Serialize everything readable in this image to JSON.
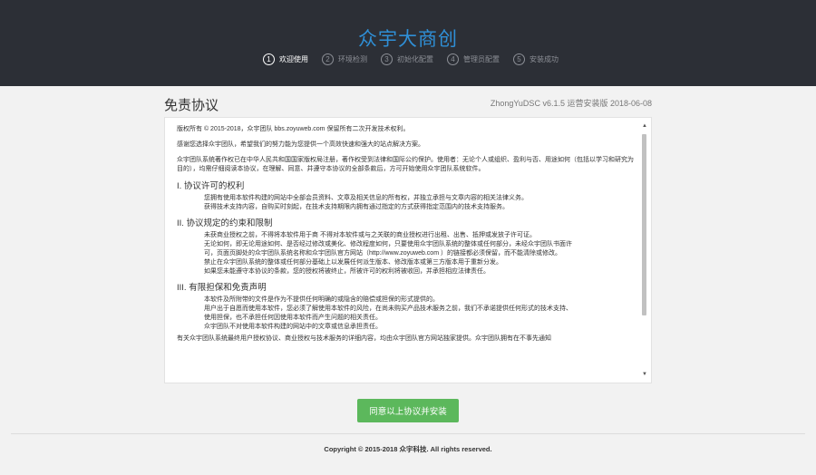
{
  "header": {
    "brand": "众宇大商创",
    "steps": [
      {
        "num": "1",
        "label": "欢迎使用",
        "active": true
      },
      {
        "num": "2",
        "label": "环境检测",
        "active": false
      },
      {
        "num": "3",
        "label": "初始化配置",
        "active": false
      },
      {
        "num": "4",
        "label": "管理员配置",
        "active": false
      },
      {
        "num": "5",
        "label": "安装成功",
        "active": false
      }
    ]
  },
  "main": {
    "title": "免责协议",
    "version": "ZhongYuDSC  v6.1.5  运营安装版  2018-06-08"
  },
  "agreement": {
    "p1": "版权所有 © 2015-2018，众宇团队 bbs.zoyuweb.com 保留所有二次开发技术权利。",
    "p2": "感谢您选择众宇团队，希望我们的努力能为您提供一个高效快速和强大的站点解决方案。",
    "p3": "众宇团队系统著作权已在中华人民共和国国家版权局注册，著作权受到法律和国际公约保护。使用者：无论个人或组织、盈利与否、用途如何（包括以学习和研究为目的），均需仔细阅读本协议，在理解、同意、并遵守本协议的全部条款后，方可开始使用众宇团队系统软件。",
    "h1": "I. 协议许可的权利",
    "s1": [
      "您拥有使用本软件构建的网站中全部会员资料、文章及相关信息的所有权，并独立承担与文章内容的相关法律义务。",
      "获得技术支持内容，自购买时刻起，在技术支持期限内拥有通过指定的方式获得指定范围内的技术支持服务。"
    ],
    "h2": "II. 协议规定的约束和限制",
    "s2": [
      "未获商业授权之前，不得将本软件用于商    不得对本软件或与之关联的商业授权进行出租、出售、抵押或发放子许可证。",
      "无论如何，即无论用途如何、是否经过修改或美化、修改程度如何，只要使用众宇团队系统的整体或任何部分，未经众宇团队书面许",
      "可，页面页脚处的众宇团队系统名称和众宇团队官方网站（http://www.zoyuweb.com ）的链接都必须保留，而不能清除或修改。",
      "禁止在众宇团队系统的整体或任何部分基础上以发展任何派生版本、修改版本或第三方版本用于重新分发。",
      "如果您未能遵守本协议的条款，您的授权将被终止，所被许可的权利将被收回，并承担相应法律责任。"
    ],
    "h3": "III. 有限担保和免责声明",
    "s3": [
      "本软件及所附带的文件是作为不提供任何明确的或隐含的赔偿或担保的形式提供的。",
      "用户出于自愿而使用本软件，您必须了解使用本软件的风险，在尚未购买产品技术服务之前，我们不承诺提供任何形式的技术支持、",
      "使用担保，也不承担任何因使用本软件而产生问题的相关责任。",
      "众宇团队不对使用本软件构建的网站中的文章或信息承担责任。"
    ],
    "p_last": "有关众宇团队系统最终用户授权协议、商业授权与技术服务的详细内容，均由众宇团队官方网站独家提供。众宇团队拥有在不事先通知"
  },
  "actions": {
    "agree_label": "同意以上协议并安装"
  },
  "footer": {
    "copyright": "Copyright © 2015-2018  众宇科技.  All rights reserved."
  },
  "colors": {
    "header_bg": "#2c2f36",
    "brand": "#2f8fd6",
    "button": "#5cb85c"
  }
}
